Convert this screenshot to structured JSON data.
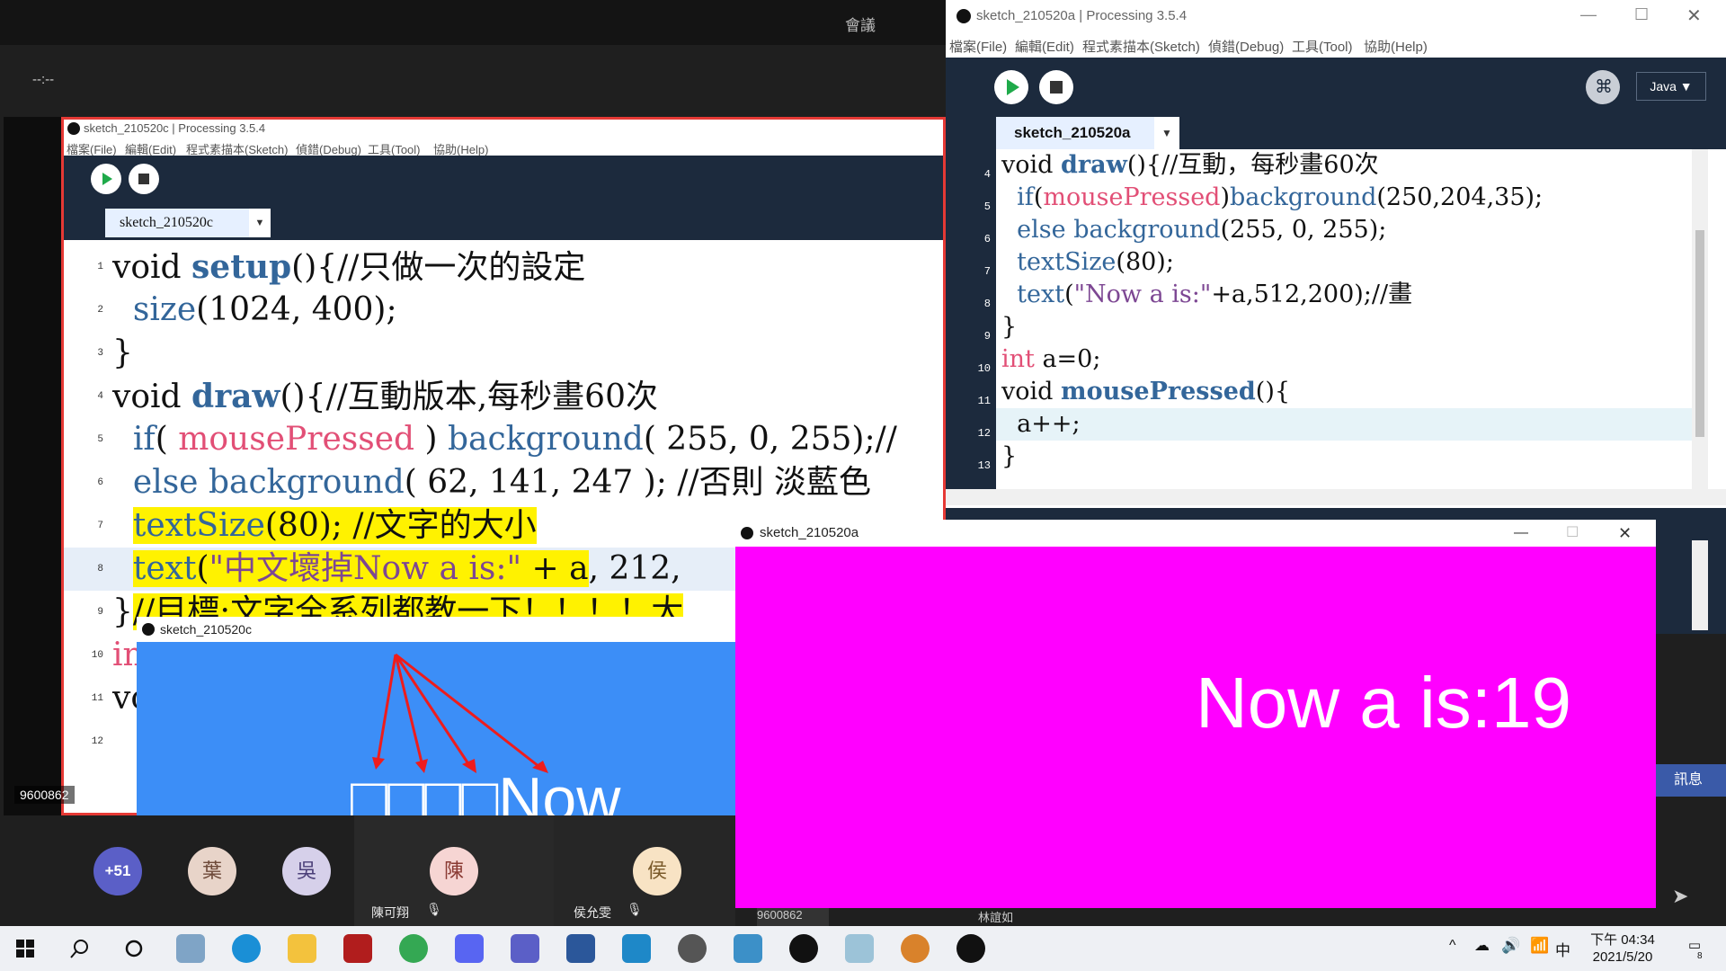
{
  "meeting": {
    "title": "會議",
    "timer": "--:--",
    "presenter_tag": "9600862",
    "participants": [
      {
        "initial": "+51",
        "color": "#5b5fc7",
        "text_color": "#ffffff"
      },
      {
        "initial": "葉",
        "color": "#e8d4c9",
        "text_color": "#6e4a3a"
      },
      {
        "initial": "吳",
        "color": "#d6d0ea",
        "text_color": "#4b3f78"
      },
      {
        "initial": "陳",
        "color": "#f6d5d3",
        "text_color": "#8a3a33",
        "name": "陳可翔"
      },
      {
        "initial": "侯",
        "color": "#f8e3c4",
        "text_color": "#7a5a2a",
        "name": "侯允雯"
      }
    ],
    "hidden_names": [
      "9600862",
      "林誼如"
    ],
    "message_button": "訊息"
  },
  "inner_ide": {
    "title": "sketch_210520c | Processing 3.5.4",
    "menu": [
      "檔案(File)",
      "編輯(Edit)",
      "程式素描本(Sketch)",
      "偵錯(Debug)",
      "工具(Tool)",
      "協助(Help)"
    ],
    "tab": "sketch_210520c",
    "tab_arrow": "▼",
    "line_numbers": [
      "1",
      "2",
      "3",
      "4",
      "5",
      "6",
      "7",
      "8",
      "9",
      "10",
      "11",
      "12"
    ]
  },
  "right_ide": {
    "title": "sketch_210520a | Processing 3.5.4",
    "menu": [
      "檔案(File)",
      "編輯(Edit)",
      "程式素描本(Sketch)",
      "偵錯(Debug)",
      "工具(Tool)",
      "協助(Help)"
    ],
    "tab": "sketch_210520a",
    "tab_arrow": "▼",
    "mode": "Java ▼",
    "line_numbers": [
      "4",
      "5",
      "6",
      "7",
      "8",
      "9",
      "10",
      "11",
      "12",
      "13"
    ]
  },
  "sketch_c": {
    "title": "sketch_210520c",
    "canvas_text": "□□□□Now",
    "bg_color": "#3c8ef7"
  },
  "sketch_a": {
    "title": "sketch_210520a",
    "canvas_text": "Now a is:19",
    "bg_color": "#ff00ff"
  },
  "taskbar": {
    "time": "下午 04:34",
    "date": "2021/5/20",
    "ime": "中",
    "notifications": "8"
  }
}
